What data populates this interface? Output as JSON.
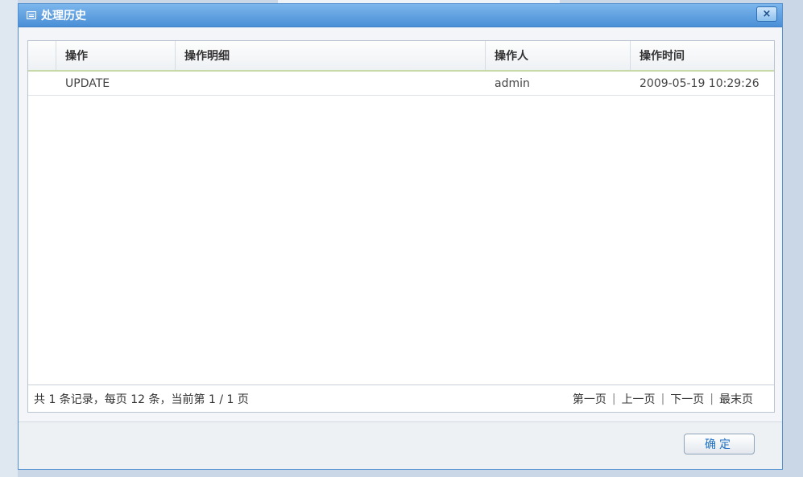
{
  "dialog": {
    "title": "处理历史",
    "close_label": "×"
  },
  "grid": {
    "columns": [
      "",
      "操作",
      "操作明细",
      "操作人",
      "操作时间"
    ],
    "rows": [
      {
        "action": "UPDATE",
        "detail": "",
        "operator": "admin",
        "time": "2009-05-19 10:29:26"
      }
    ]
  },
  "pager": {
    "summary": "共 1 条记录，每页 12 条，当前第 1 / 1 页",
    "first": "第一页",
    "prev": "上一页",
    "next": "下一页",
    "last": "最末页",
    "separator": "|"
  },
  "footer": {
    "ok_label": "确定"
  },
  "icons": {
    "title": "window-icon",
    "close": "close-icon"
  }
}
